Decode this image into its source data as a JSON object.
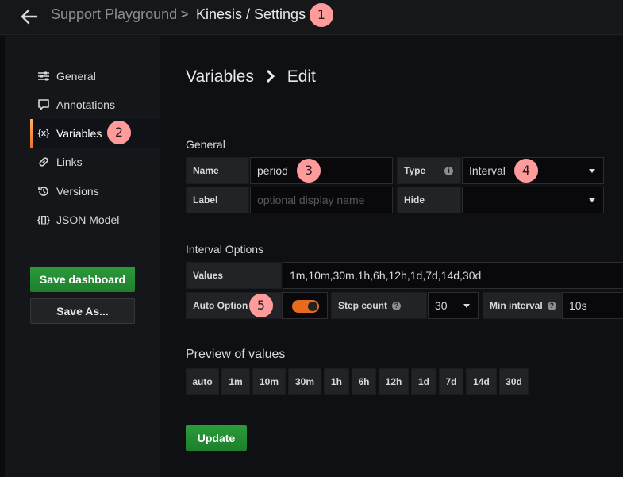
{
  "header": {
    "parent_title": "Support Playground",
    "separator": ">",
    "current_title": "Kinesis / Settings",
    "back_icon": "arrow-left-icon"
  },
  "badges": [
    "1",
    "2",
    "3",
    "4",
    "5"
  ],
  "sidebar": {
    "items": [
      {
        "label": "General",
        "icon": "sliders-icon"
      },
      {
        "label": "Annotations",
        "icon": "comment-icon"
      },
      {
        "label": "Variables",
        "icon": "variable-icon",
        "active": true
      },
      {
        "label": "Links",
        "icon": "link-icon"
      },
      {
        "label": "Versions",
        "icon": "history-icon"
      },
      {
        "label": "JSON Model",
        "icon": "json-icon"
      }
    ],
    "variables_icon_text": "{x}",
    "json_icon_text": "{[]}",
    "save_dashboard": "Save dashboard",
    "save_as": "Save As..."
  },
  "main": {
    "title_left": "Variables",
    "title_right": "Edit",
    "general_heading": "General",
    "name_label": "Name",
    "name_value": "period",
    "type_label": "Type",
    "type_value": "Interval",
    "label_label": "Label",
    "label_placeholder": "optional display name",
    "hide_label": "Hide",
    "hide_value": "",
    "interval_heading": "Interval Options",
    "values_label": "Values",
    "values_value": "1m,10m,30m,1h,6h,12h,1d,7d,14d,30d",
    "auto_option_label": "Auto Option",
    "auto_option_on": true,
    "step_count_label": "Step count",
    "step_count_value": "30",
    "min_interval_label": "Min interval",
    "min_interval_value": "10s",
    "preview_heading": "Preview of values",
    "preview_values": [
      "auto",
      "1m",
      "10m",
      "30m",
      "1h",
      "6h",
      "12h",
      "1d",
      "7d",
      "14d",
      "30d"
    ],
    "update_button": "Update"
  },
  "colors": {
    "accent_orange": "#f46f2f",
    "button_green": "#299c46",
    "badge_pink": "#ff9b9b"
  }
}
